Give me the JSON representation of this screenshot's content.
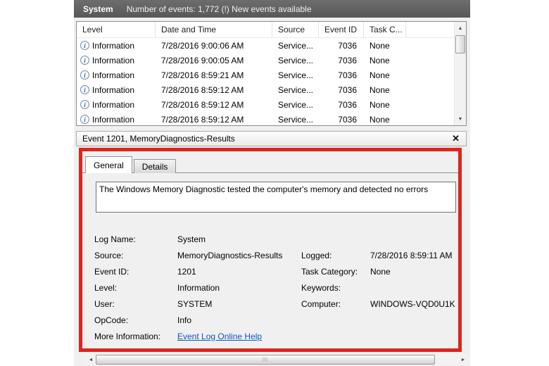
{
  "colors": {
    "accent_red": "#e0241a",
    "titlebar_bg": "#5f5f5f",
    "link_blue": "#0a55c4",
    "pane_bg": "#f0f0f0"
  },
  "icons": {
    "info_glyph": "i",
    "close_glyph": "✕",
    "scroll_up_glyph": "▲",
    "scroll_down_glyph": "▼",
    "scroll_left_glyph": "◄",
    "scroll_right_glyph": "►",
    "grip_glyph": "|||"
  },
  "titlebar": {
    "log_name": "System",
    "status": "Number of events: 1,772 (!) New events available"
  },
  "event_table": {
    "columns": [
      "Level",
      "Date and Time",
      "Source",
      "Event ID",
      "Task C..."
    ],
    "rows": [
      {
        "level": "Information",
        "date": "7/28/2016 9:00:06 AM",
        "source": "Service...",
        "event_id": "7036",
        "task": "None"
      },
      {
        "level": "Information",
        "date": "7/28/2016 9:00:05 AM",
        "source": "Service...",
        "event_id": "7036",
        "task": "None"
      },
      {
        "level": "Information",
        "date": "7/28/2016 8:59:21 AM",
        "source": "Service...",
        "event_id": "7036",
        "task": "None"
      },
      {
        "level": "Information",
        "date": "7/28/2016 8:59:12 AM",
        "source": "Service...",
        "event_id": "7036",
        "task": "None"
      },
      {
        "level": "Information",
        "date": "7/28/2016 8:59:12 AM",
        "source": "Service...",
        "event_id": "7036",
        "task": "None"
      },
      {
        "level": "Information",
        "date": "7/28/2016 8:59:12 AM",
        "source": "Service...",
        "event_id": "7036",
        "task": "None"
      }
    ]
  },
  "detail_pane": {
    "title": "Event 1201, MemoryDiagnostics-Results",
    "tabs": [
      "General",
      "Details"
    ],
    "active_tab": "General",
    "message": "The Windows Memory Diagnostic tested the computer's memory and detected no errors",
    "fields": [
      {
        "label_left": "Log Name:",
        "value_left": "System",
        "label_right": "",
        "value_right": ""
      },
      {
        "label_left": "Source:",
        "value_left": "MemoryDiagnostics-Results",
        "label_right": "Logged:",
        "value_right": "7/28/2016 8:59:11 AM"
      },
      {
        "label_left": "Event ID:",
        "value_left": "1201",
        "label_right": "Task Category:",
        "value_right": "None"
      },
      {
        "label_left": "Level:",
        "value_left": "Information",
        "label_right": "Keywords:",
        "value_right": ""
      },
      {
        "label_left": "User:",
        "value_left": "SYSTEM",
        "label_right": "Computer:",
        "value_right": "WINDOWS-VQD0U1K"
      },
      {
        "label_left": "OpCode:",
        "value_left": "Info",
        "label_right": "",
        "value_right": ""
      },
      {
        "label_left": "More Information:",
        "value_left": "Event Log Online Help",
        "label_right": "",
        "value_right": ""
      }
    ]
  }
}
